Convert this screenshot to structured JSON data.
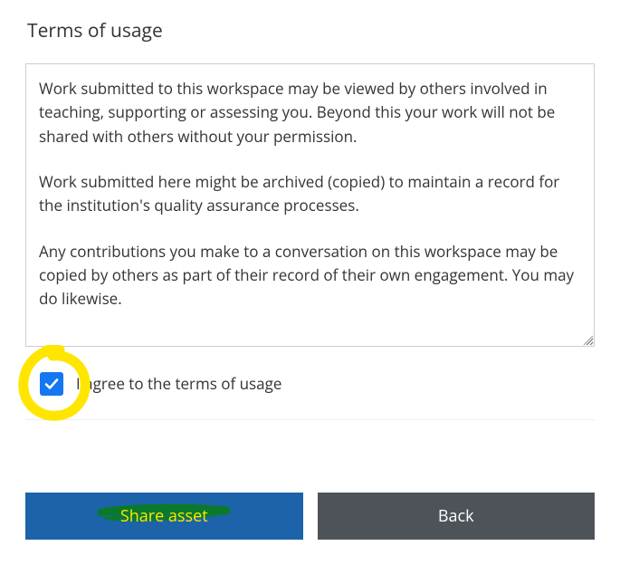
{
  "title": "Terms of usage",
  "terms": {
    "p1": "Work submitted to this workspace may be viewed by others involved in teaching, supporting or assessing you. Beyond this your work will not be shared with others without your permission.",
    "p2": "Work submitted here might be archived (copied) to maintain a record for the institution's quality assurance processes.",
    "p3": "Any contributions you make to a conversation on this workspace may be copied by others as part of their record of their own engagement. You may do likewise."
  },
  "agree": {
    "checked": true,
    "label": "I agree to the terms of usage"
  },
  "buttons": {
    "primary": "Share asset",
    "secondary": "Back"
  },
  "annotations": {
    "checkbox_highlight_color": "#ffe600",
    "button_highlight_color": "#0a7a2a"
  }
}
